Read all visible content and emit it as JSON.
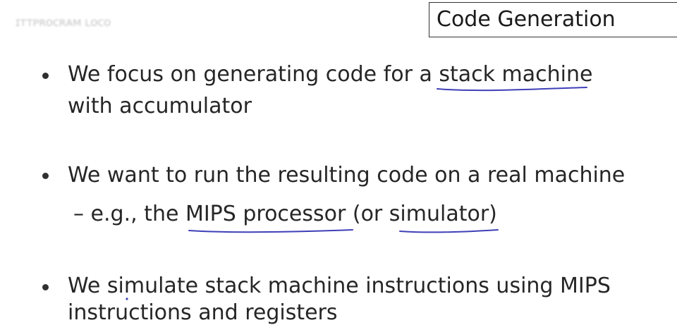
{
  "watermark": "ɪᴛᴛᴘʀᴏᴄʀᴀᴍ ʟᴏᴄᴏ",
  "title": "Code Generation",
  "bullets": [
    {
      "line1": "We focus on generating code for a stack machine",
      "line2": "with accumulator"
    },
    {
      "line1": "We want to run the resulting code on a real machine",
      "sub": "– e.g., the MIPS processor (or simulator)"
    },
    {
      "line1": "We simulate stack machine instructions using MIPS",
      "line2": "instructions and registers"
    }
  ]
}
